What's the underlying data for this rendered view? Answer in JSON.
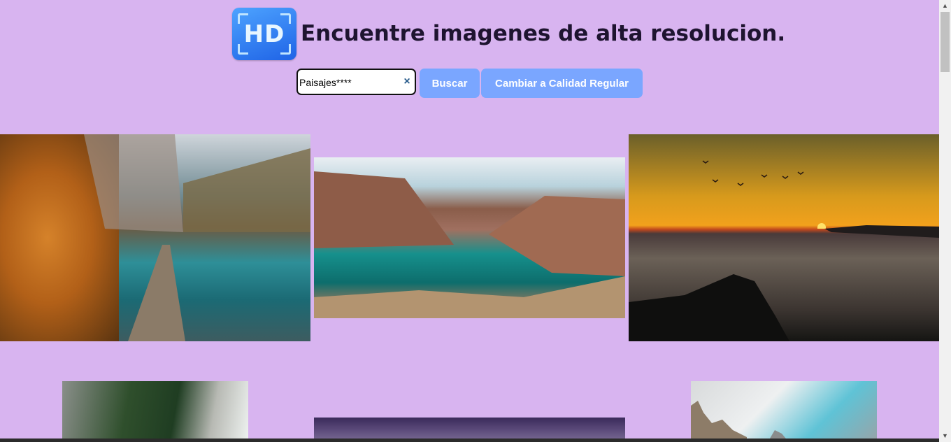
{
  "header": {
    "logo_text": "HD",
    "title": "Encuentre imagenes de alta resolucion."
  },
  "search": {
    "value": "Paisajes****",
    "clear_glyph": "×",
    "search_button": "Buscar",
    "quality_button": "Cambiar a Calidad Regular"
  },
  "gallery": {
    "images": [
      {
        "name": "autumn-lake-pier-photo"
      },
      {
        "name": "fjord-turquoise-water-photo"
      },
      {
        "name": "sunset-over-sea-with-birds-photo"
      },
      {
        "name": "forest-waterfall-photo"
      },
      {
        "name": "purple-sky-photo"
      },
      {
        "name": "rocky-peaks-clouds-photo"
      }
    ]
  },
  "scrollbar": {
    "up_glyph": "▲",
    "down_glyph": "▼"
  },
  "colors": {
    "background": "#d8b4f0",
    "button": "#7aa6ff",
    "logo": "#1f63e6"
  }
}
